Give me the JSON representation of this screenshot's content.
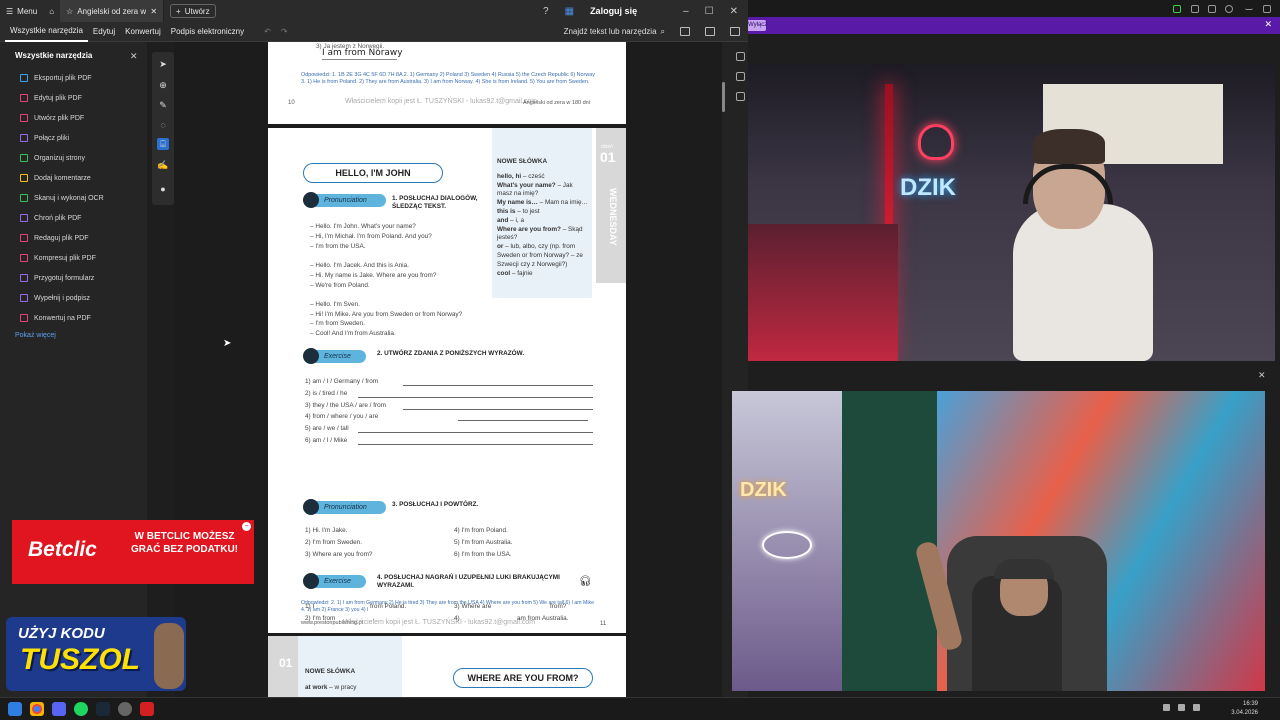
{
  "titlebar": {
    "menu_label": "Menu",
    "tab_title": "Angielski od zera w ...",
    "new_tab_label": "Utwórz",
    "login_label": "Zaloguj się"
  },
  "menubar": {
    "items": [
      "Wszystkie narzędzia",
      "Edytuj",
      "Konwertuj",
      "Podpis elektroniczny"
    ],
    "find_label": "Znajdź tekst lub narzędzia"
  },
  "left_panel": {
    "title": "Wszystkie narzędzia",
    "items": [
      {
        "label": "Eksportuj plik PDF",
        "color": "#3aa0e8"
      },
      {
        "label": "Edytuj plik PDF",
        "color": "#e8417a"
      },
      {
        "label": "Utwórz plik PDF",
        "color": "#e8417a"
      },
      {
        "label": "Połącz pliki",
        "color": "#9b6ae8"
      },
      {
        "label": "Organizuj strony",
        "color": "#3cc05a"
      },
      {
        "label": "Dodaj komentarze",
        "color": "#f0c020"
      },
      {
        "label": "Skanuj i wykonaj OCR",
        "color": "#3cc05a"
      },
      {
        "label": "Chroń plik PDF",
        "color": "#9b6ae8"
      },
      {
        "label": "Redaguj plik PDF",
        "color": "#e8417a"
      },
      {
        "label": "Kompresuj plik PDF",
        "color": "#e8417a"
      },
      {
        "label": "Przygotuj formularz",
        "color": "#9b6ae8"
      },
      {
        "label": "Wypełnij i podpisz",
        "color": "#9b6ae8"
      },
      {
        "label": "Konwertuj na PDF",
        "color": "#e8417a"
      }
    ],
    "show_more": "Pokaż więcej"
  },
  "page_top": {
    "item3": "3)  Ja jestem z Norwegii.",
    "handwritten": "I am from Norawy",
    "answers": "Odpowiedzi: 1. 1B 2E 3G 4C 5F 6D 7H 8A 2. 1) Germany 2) Poland 3) Sweden 4) Russia 5) the Czech Republic 6) Norway 3. 1) He is from Poland. 2) They are from Australia. 3) I am from Norway. 4) She is from Ireland. 5) You are from Sweden.",
    "page_num": "10",
    "footer": "Właścicielem kopii jest Ł. TUSZYŃSKI - lukas92.t@gmail.com",
    "footer_right": "Angielski od zera w 180 dni"
  },
  "page_main": {
    "hello_title": "HELLO, I'M JOHN",
    "day_num": "01",
    "day_label_small": "dzień",
    "day_name": "WEDNESDAY",
    "vocab_title": "NOWE SŁÓWKA",
    "vocab": [
      {
        "en": "hello, hi",
        "pl": " – cześć"
      },
      {
        "en": "What's your name?",
        "pl": " – Jak masz na imię?"
      },
      {
        "en": "My name is… ",
        "pl": "– Mam na imię…"
      },
      {
        "en": "this is",
        "pl": " – to jest"
      },
      {
        "en": "and",
        "pl": " – i, a"
      },
      {
        "en": "Where are you from?",
        "pl": " – Skąd jesteś?"
      },
      {
        "en": "or",
        "pl": " – lub, albo, czy (np. from Sweden or from Norway? – ze Szwecji czy z Norwegii?)"
      },
      {
        "en": "cool",
        "pl": " – fajnie"
      }
    ],
    "badge_pron": "Pronunciation",
    "badge_ex": "Exercise",
    "sec1": "1.  POSŁUCHAJ DIALOGÓW, ŚLEDZĄC TEKST.",
    "dialog1": [
      "–  Hello. I'm John. What's your name?",
      "–  Hi, I'm Michał. I'm from Poland. And you?",
      "–  I'm from the USA."
    ],
    "dialog2": [
      "–  Hello. I'm Jacek. And this is Ania.",
      "–  Hi. My name is Jake. Where are you from?",
      "–  We're from Poland."
    ],
    "dialog3": [
      "–  Hello. I'm Sven.",
      "–  Hi! I'm Mike. Are you from Sweden or from Norway?",
      "–  I'm from Sweden.",
      "–  Cool! And I'm from Australia."
    ],
    "sec2": "2.  UTWÓRZ ZDANIA Z PONIŻSZYCH WYRAZÓW.",
    "ex2": [
      "1)  am / I / Germany / from",
      "2)  is / tired / he",
      "3)  they / the USA / are / from",
      "4)  from / where / you / are",
      "5)  are / we / tall",
      "6)  am / I / Mike"
    ],
    "sec3": "3.  POSŁUCHAJ I POWTÓRZ.",
    "ex3_left": [
      "1)  Hi. I'm Jake.",
      "2)  I'm from Sweden.",
      "3)  Where are you from?"
    ],
    "ex3_right": [
      "4)  I'm from Poland.",
      "5)  I'm from Australia.",
      "6)  I'm from the USA."
    ],
    "sec4": "4.  POSŁUCHAJ NAGRAŃ I UZUPEŁNIJ LUKI BRAKUJĄCYMI WYRAZAMI.",
    "ex4_left": [
      "1)  I",
      "2)  I'm from"
    ],
    "ex4_left_end": [
      "from Poland.",
      "."
    ],
    "ex4_right": [
      "3)  Where are",
      "4)"
    ],
    "ex4_right_end": [
      "from?",
      "am from Australia."
    ],
    "answers": "Odpowiedzi: 2. 1) I am from Germany 2) He is tired 3) They are from the USA 4) Where are you from 5) We are tall 6) I am Mike 4. 1) am 2) France 3) you 4) I",
    "site": "www.prestonpublishing.pl",
    "footer": "Właścicielem kopii jest Ł. TUSZYŃSKI - lukas92.t@gmail.com",
    "page_num": "11"
  },
  "page_next": {
    "vocab_title": "NOWE SŁÓWKA",
    "vocab_first": "at work",
    "vocab_first_pl": " – w pracy",
    "title": "WHERE ARE YOU FROM?",
    "day_num": "01"
  },
  "stream": {
    "purple_btn": "Wyłącz",
    "neon_text": "DZIK",
    "neon_text2": "DZIK"
  },
  "ads": {
    "betclic_brand": "Betclic",
    "betclic_slogan": "W BETCLIC MOŻESZ GRAĆ BEZ PODATKU!",
    "code_line1": "UŻYJ KODU",
    "code_line2": "TUSZOL"
  },
  "taskbar": {
    "time": "16:39",
    "date": "3.04.2026"
  },
  "colors": {
    "accent_blue": "#2a7ab8",
    "badge_blue": "#5fb4de",
    "betclic_red": "#e0151f",
    "purple": "#5a1aa8"
  }
}
